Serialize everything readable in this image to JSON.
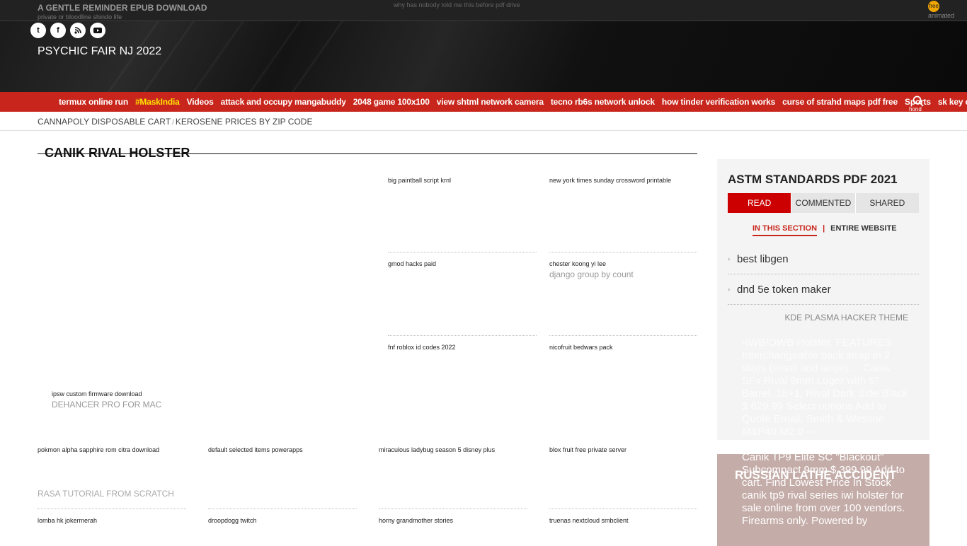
{
  "topbar": {
    "left": "A GENTLE REMINDER EPUB DOWNLOAD",
    "left_sub": "private or bloodline shindo life",
    "center": "why has nobody told me this before pdf drive",
    "badge": "free",
    "right_sub": "animated"
  },
  "header": {
    "site_title": "PSYCHIC FAIR NJ 2022",
    "social": [
      "twitter-icon",
      "facebook-icon",
      "rss-icon",
      "youtube-icon"
    ]
  },
  "nav": {
    "items": [
      {
        "label": "termux online run",
        "highlight": false
      },
      {
        "label": "#MaskIndia",
        "highlight": true
      },
      {
        "label": "Videos",
        "highlight": false
      },
      {
        "label": "attack and occupy mangabuddy",
        "highlight": false
      },
      {
        "label": "2048 game 100x100",
        "highlight": false
      },
      {
        "label": "view shtml network camera",
        "highlight": false
      },
      {
        "label": "tecno rb6s network unlock",
        "highlight": false
      },
      {
        "label": "how tinder verification works",
        "highlight": false
      },
      {
        "label": "curse of strahd maps pdf free",
        "highlight": false
      },
      {
        "label": "Sports",
        "highlight": false
      },
      {
        "label": "sk key checker",
        "highlight": false
      }
    ],
    "search_sub": "hond"
  },
  "breadcrumb": {
    "first": "CANNAPOLY DISPOSABLE CART",
    "separator": "/",
    "second": "KEROSENE PRICES BY ZIP CODE"
  },
  "main": {
    "title": "CANIK RIVAL HOLSTER",
    "tiles_right": [
      {
        "label": "big paintball script krnl",
        "sub": ""
      },
      {
        "label": "new york times sunday crossword printable",
        "sub": ""
      },
      {
        "label": "gmod hacks paid",
        "sub": ""
      },
      {
        "label": "chester koong yi lee",
        "sub": "django group by count"
      },
      {
        "label": "fnf roblox id codes 2022",
        "sub": ""
      },
      {
        "label": "nicofruit bedwars pack",
        "sub": ""
      }
    ],
    "big_tile": {
      "label": "ipsw custom firmware download",
      "sub": "DEHANCER PRO FOR MAC"
    },
    "row1": [
      "pokmon alpha sapphire rom citra download",
      "default selected items powerapps",
      "miraculous ladybug season 5 disney plus",
      "blox fruit free private server"
    ],
    "row1_sub": "RASA TUTORIAL FROM SCRATCH",
    "row2": [
      "lomba hk jokermerah",
      "droopdogg twitch",
      "horny grandmother stories",
      "truenas nextcloud smbclient"
    ]
  },
  "sidebar": {
    "title": "ASTM STANDARDS PDF 2021",
    "tabs": [
      "READ",
      "COMMENTED",
      "SHARED"
    ],
    "subtabs": [
      "IN THIS SECTION",
      "ENTIRE WEBSITE"
    ],
    "items": [
      "best libgen",
      "dnd 5e token maker"
    ],
    "footer": "KDE PLASMA HACKER THEME",
    "overflow_1": "-IWB/OWB Holster. FEATURES Interchangeable back strap in 2 sizes (small and large) ... Canik SFx Rival 9mm Luger with 5\" Barrel, 18+1, Rival Dark Side Black $ 629.99 Select options Add to Quote Email; Smith & Wesson M&P40 M2.0 --",
    "widget2_title": "RUSSIAN LATHE ACCIDENT",
    "overflow_2": "Canik TP9 Elite SC \"Blackout\" Subcompact 9mm $ 399.99 Add to cart. Find Lowest Price In Stock canik tp9 rival series iwi holster for sale online from over 100 vendors. Firearms only. Powered by"
  },
  "colors": {
    "nav_red": "#c8261c",
    "tab_red": "#cc0000",
    "highlight_yellow": "#ffe400"
  }
}
